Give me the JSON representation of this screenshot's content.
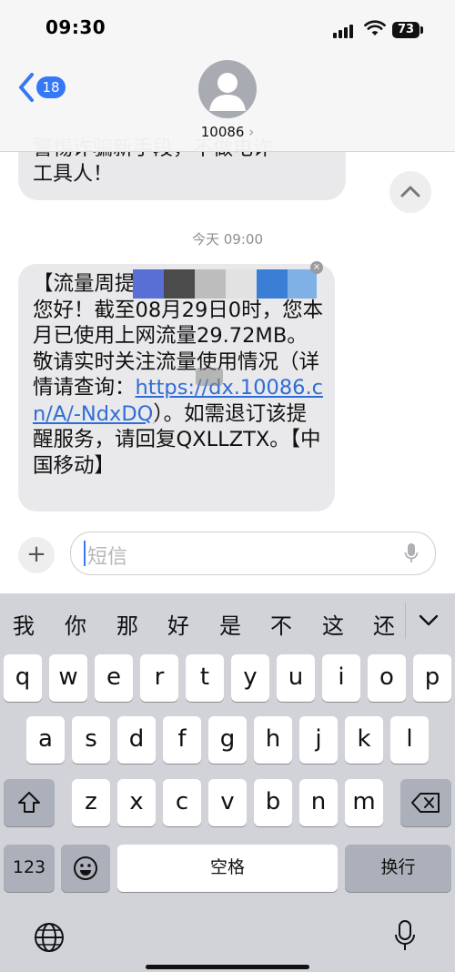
{
  "status_bar": {
    "time": "09:30",
    "battery": "73"
  },
  "header": {
    "back_count": "18",
    "contact": "10086",
    "contact_chevron": "›"
  },
  "previous_message": {
    "line1": "警惕诈骗新手段，不做电诈",
    "line2": "工具人！"
  },
  "timestamp": "今天 09:00",
  "message": {
    "text_before_link": "【流量周提",
    "text_body": "您好！截至08月29日0时，您本月已使用上网流量29.72MB。敬请实时关注流量使用情况（详情请查询：",
    "link": "https://dx.10086.cn/A/-NdxDQ",
    "text_after_link": "）。如需退订该提醒服务，请回复QXLLZTX。【中国移动】"
  },
  "composer": {
    "plus": "+",
    "placeholder": "短信"
  },
  "keyboard": {
    "candidates": [
      "我",
      "你",
      "那",
      "好",
      "是",
      "不",
      "这",
      "还"
    ],
    "row1": [
      "q",
      "w",
      "e",
      "r",
      "t",
      "y",
      "u",
      "i",
      "o",
      "p"
    ],
    "row2": [
      "a",
      "s",
      "d",
      "f",
      "g",
      "h",
      "j",
      "k",
      "l"
    ],
    "row3": [
      "z",
      "x",
      "c",
      "v",
      "b",
      "n",
      "m"
    ],
    "numbers_key": "123",
    "space_key": "空格",
    "return_key": "换行"
  },
  "colors": {
    "accent": "#3478f6",
    "bubble": "#e9e9eb",
    "link": "#2f6dd6",
    "keyboard_bg": "#d1d3d9"
  },
  "icons": [
    "back-chevron-icon",
    "person-icon",
    "chevron-up-icon",
    "mic-icon",
    "shift-icon",
    "delete-icon",
    "emoji-icon",
    "globe-icon",
    "wifi-icon",
    "signal-icon",
    "battery-icon",
    "chevron-down-icon"
  ]
}
